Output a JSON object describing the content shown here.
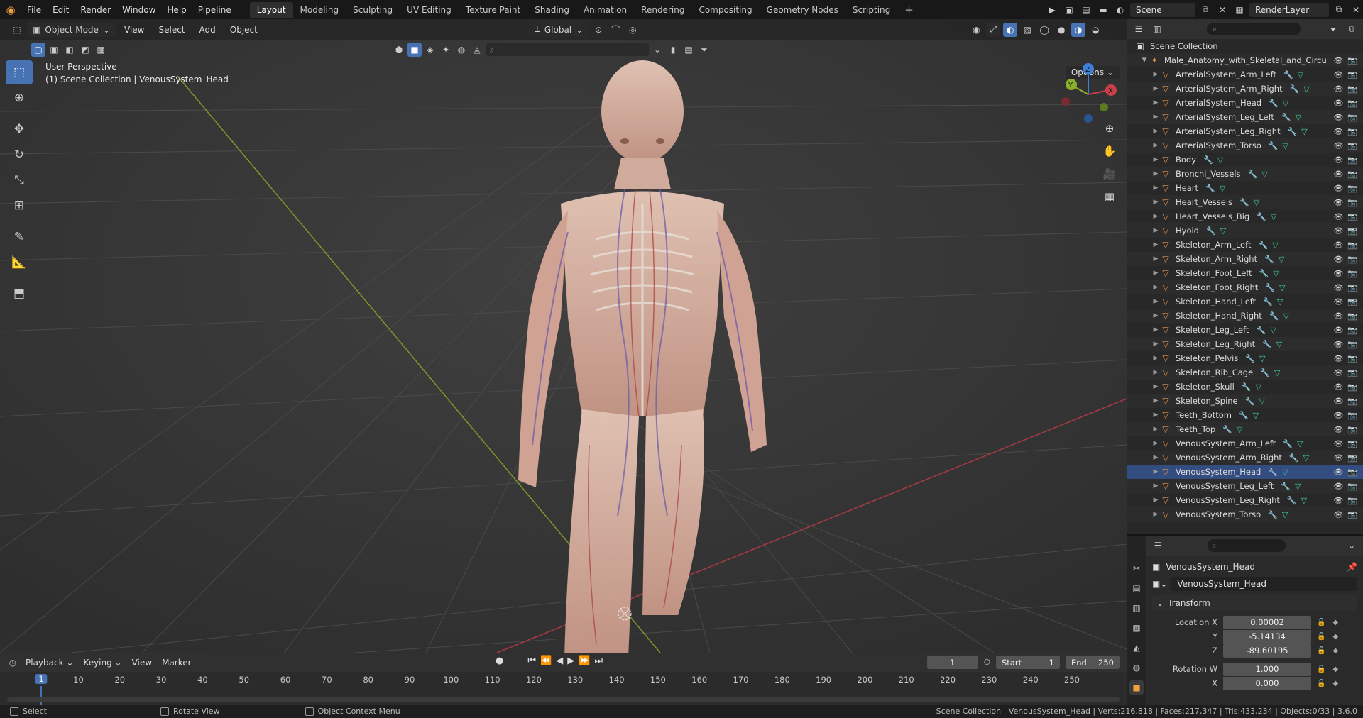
{
  "topbar": {
    "menus": [
      "File",
      "Edit",
      "Render",
      "Window",
      "Help",
      "Pipeline"
    ],
    "workspaces": [
      "Layout",
      "Modeling",
      "Sculpting",
      "UV Editing",
      "Texture Paint",
      "Shading",
      "Animation",
      "Rendering",
      "Compositing",
      "Geometry Nodes",
      "Scripting"
    ],
    "active_workspace": "Layout",
    "scene": "Scene",
    "view_layer": "RenderLayer"
  },
  "viewport": {
    "mode": "Object Mode",
    "menus": [
      "View",
      "Select",
      "Add",
      "Object"
    ],
    "orientation": "Global",
    "options": "Options",
    "perspective": "User Perspective",
    "context": "(1) Scene Collection | VenousSystem_Head",
    "gizmo": {
      "x": "X",
      "y": "Y",
      "z": "Z"
    }
  },
  "outliner": {
    "root": "Scene Collection",
    "collection": "Male_Anatomy_with_Skeletal_and_Circu",
    "objects": [
      "ArterialSystem_Arm_Left",
      "ArterialSystem_Arm_Right",
      "ArterialSystem_Head",
      "ArterialSystem_Leg_Left",
      "ArterialSystem_Leg_Right",
      "ArterialSystem_Torso",
      "Body",
      "Bronchi_Vessels",
      "Heart",
      "Heart_Vessels",
      "Heart_Vessels_Big",
      "Hyoid",
      "Skeleton_Arm_Left",
      "Skeleton_Arm_Right",
      "Skeleton_Foot_Left",
      "Skeleton_Foot_Right",
      "Skeleton_Hand_Left",
      "Skeleton_Hand_Right",
      "Skeleton_Leg_Left",
      "Skeleton_Leg_Right",
      "Skeleton_Pelvis",
      "Skeleton_Rib_Cage",
      "Skeleton_Skull",
      "Skeleton_Spine",
      "Teeth_Bottom",
      "Teeth_Top",
      "VenousSystem_Arm_Left",
      "VenousSystem_Arm_Right",
      "VenousSystem_Head",
      "VenousSystem_Leg_Left",
      "VenousSystem_Leg_Right",
      "VenousSystem_Torso"
    ],
    "selected": "VenousSystem_Head"
  },
  "properties": {
    "object_name": "VenousSystem_Head",
    "datablock": "VenousSystem_Head",
    "panel": "Transform",
    "rows": [
      {
        "label": "Location X",
        "value": "0.00002"
      },
      {
        "label": "Y",
        "value": "-5.14134"
      },
      {
        "label": "Z",
        "value": "-89.60195"
      },
      {
        "label": "Rotation W",
        "value": "1.000"
      },
      {
        "label": "X",
        "value": "0.000"
      }
    ]
  },
  "timeline": {
    "menus": [
      "Playback",
      "Keying",
      "View",
      "Marker"
    ],
    "current_frame": "1",
    "start_label": "Start",
    "start": "1",
    "end_label": "End",
    "end": "250",
    "ticks": [
      "10",
      "20",
      "30",
      "40",
      "50",
      "60",
      "70",
      "80",
      "90",
      "100",
      "110",
      "120",
      "130",
      "140",
      "150",
      "160",
      "170",
      "180",
      "190",
      "200",
      "210",
      "220",
      "230",
      "240",
      "250"
    ]
  },
  "statusbar": {
    "select": "Select",
    "rotate": "Rotate View",
    "context_menu": "Object Context Menu",
    "stats": "Scene Collection | VenousSystem_Head | Verts:216,818 | Faces:217,347 | Tris:433,234 | Objects:0/33 | 3.6.0"
  },
  "colors": {
    "accent": "#4772b3",
    "object_icon": "#e8924a",
    "x_axis": "#c8404a",
    "y_axis": "#8bb02c",
    "z_axis": "#3f7fd8"
  }
}
